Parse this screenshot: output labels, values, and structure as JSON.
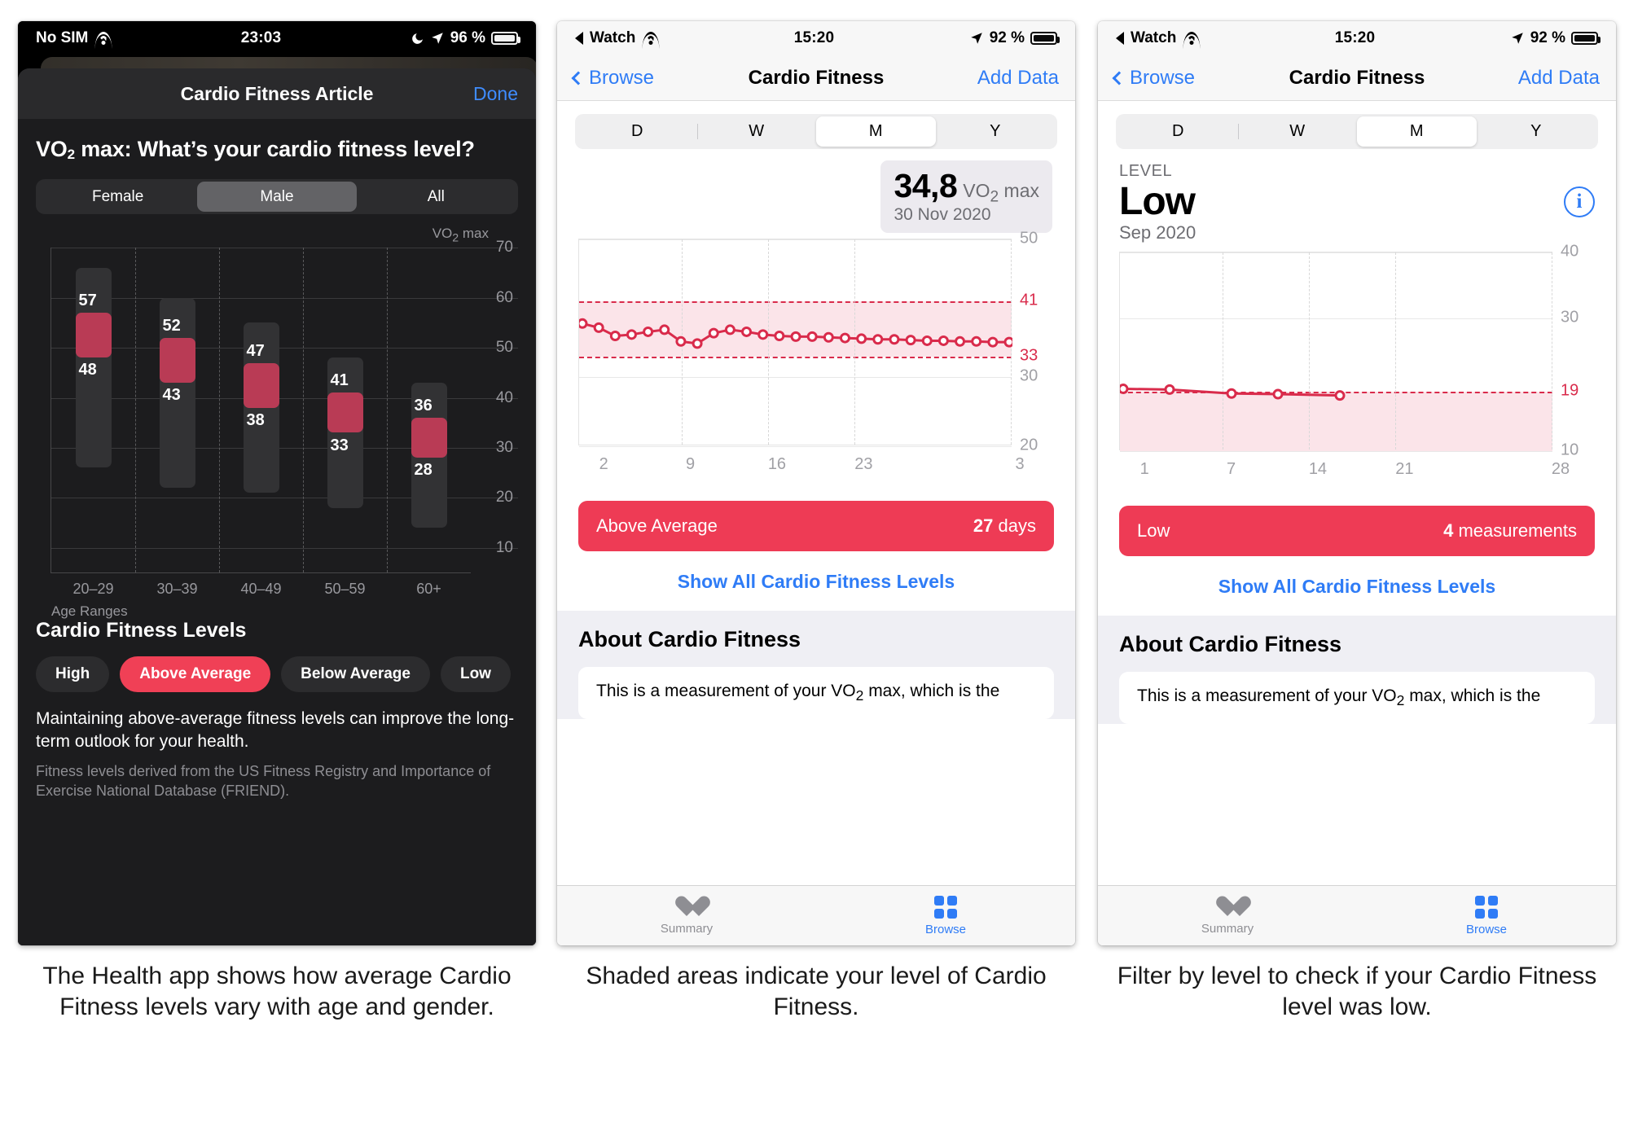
{
  "panel1": {
    "status": {
      "carrier": "No SIM",
      "wifi_icon": "wifi-icon",
      "time": "23:03",
      "moon_icon": "moon-icon",
      "location_icon": "location-arrow-icon",
      "battery": "96 %",
      "battery_icon": "battery-icon"
    },
    "nav": {
      "title": "Cardio Fitness Article",
      "done": "Done"
    },
    "heading_a": "VO",
    "heading_sub": "2",
    "heading_b": " max: What’s your cardio fitness level?",
    "gender_segments": [
      "Female",
      "Male",
      "All"
    ],
    "gender_selected": "Male",
    "axis_unit_a": "VO",
    "axis_unit_sub": "2",
    "axis_unit_b": " max",
    "x_axis_label": "Age Ranges",
    "levels_title": "Cardio Fitness Levels",
    "level_chips": [
      "High",
      "Above Average",
      "Below Average",
      "Low"
    ],
    "level_selected": "Above Average",
    "body_text": "Maintaining above-average fitness levels can improve the long-term outlook for your health.",
    "footnote": "Fitness levels derived from the US Fitness Registry and Importance of Exercise National Database (FRIEND)."
  },
  "panel2": {
    "status": {
      "source": "Watch",
      "back_icon": "back-triangle-icon",
      "wifi_icon": "wifi-icon",
      "time": "15:20",
      "location_icon": "location-arrow-icon",
      "battery": "92 %",
      "battery_icon": "battery-icon"
    },
    "nav": {
      "back": "Browse",
      "title": "Cardio Fitness",
      "action": "Add Data"
    },
    "range_segments": [
      "D",
      "W",
      "M",
      "Y"
    ],
    "range_selected": "M",
    "value": "34,8",
    "value_unit_a": "VO",
    "value_unit_sub": "2",
    "value_unit_b": " max",
    "value_date": "30 Nov 2020",
    "level_bar": {
      "label": "Above Average",
      "count": "27",
      "count_unit": "days"
    },
    "show_all": "Show All Cardio Fitness Levels",
    "about_title": "About Cardio Fitness",
    "about_text_a": "This is a measurement of your VO",
    "about_text_sub": "2",
    "about_text_b": " max, which is the",
    "tabs": [
      {
        "label": "Summary",
        "icon": "heart-icon",
        "active": false
      },
      {
        "label": "Browse",
        "icon": "grid-squares-icon",
        "active": true
      }
    ]
  },
  "panel3": {
    "status": {
      "source": "Watch",
      "back_icon": "back-triangle-icon",
      "wifi_icon": "wifi-icon",
      "time": "15:20",
      "location_icon": "location-arrow-icon",
      "battery": "92 %",
      "battery_icon": "battery-icon"
    },
    "nav": {
      "back": "Browse",
      "title": "Cardio Fitness",
      "action": "Add Data"
    },
    "range_segments": [
      "D",
      "W",
      "M",
      "Y"
    ],
    "range_selected": "M",
    "kicker": "LEVEL",
    "level": "Low",
    "period": "Sep 2020",
    "info_icon": "info-circle-icon",
    "info_glyph": "i",
    "level_bar": {
      "label": "Low",
      "count": "4",
      "count_unit": "measurements"
    },
    "show_all": "Show All Cardio Fitness Levels",
    "about_title": "About Cardio Fitness",
    "about_text_a": "This is a measurement of your VO",
    "about_text_sub": "2",
    "about_text_b": " max, which is the",
    "tabs": [
      {
        "label": "Summary",
        "icon": "heart-icon",
        "active": false
      },
      {
        "label": "Browse",
        "icon": "grid-squares-icon",
        "active": true
      }
    ]
  },
  "captions": {
    "c1": "The Health app shows how average Cardio Fitness levels vary with age and gender.",
    "c2": "Shaded areas indicate your level of Cardio Fitness.",
    "c3": "Filter by level to check if your Cardio Fitness level was low."
  },
  "colors": {
    "accent_red": "#ee3b55",
    "chart_red": "#d92b4b",
    "bar_red": "#b93b55",
    "band_pink": "#fbe4e9",
    "blue": "#2f7cf6",
    "dark_bg": "#1c1c1e"
  },
  "chart_data": [
    {
      "type": "bar",
      "id": "panel1-age-ranges",
      "title": "VO2 max by age range (Male)",
      "ylabel": "VO2 max",
      "xlabel": "Age Ranges",
      "ylim": [
        5,
        70
      ],
      "yticks": [
        70,
        60,
        50,
        40,
        30,
        20,
        10
      ],
      "categories": [
        "20–29",
        "30–39",
        "40–49",
        "50–59",
        "60+"
      ],
      "series": [
        {
          "name": "range_top",
          "values": [
            66,
            60,
            55,
            48,
            43
          ]
        },
        {
          "name": "above_avg_high",
          "values": [
            57,
            52,
            47,
            41,
            36
          ]
        },
        {
          "name": "above_avg_low",
          "values": [
            48,
            43,
            38,
            33,
            28
          ]
        },
        {
          "name": "range_bottom",
          "values": [
            26,
            22,
            21,
            18,
            14
          ]
        }
      ],
      "highlight_band_label": "Above Average",
      "data_labels_top": [
        57,
        52,
        47,
        41,
        36
      ],
      "data_labels_bottom": [
        48,
        43,
        38,
        33,
        28
      ],
      "grid": true
    },
    {
      "type": "line",
      "id": "panel2-monthly-vo2max",
      "ylim": [
        20,
        50
      ],
      "yticks": [
        50,
        41,
        33,
        30,
        20
      ],
      "red_ticks": [
        41,
        33
      ],
      "xticks": [
        "2",
        "9",
        "16",
        "23",
        "3"
      ],
      "band": {
        "from": 33,
        "to": 41,
        "label": "Above Average"
      },
      "x": [
        1,
        2,
        3,
        4,
        5,
        6,
        7,
        8,
        9,
        10,
        11,
        12,
        13,
        14,
        15,
        16,
        17,
        18,
        19,
        20,
        21,
        22,
        23,
        24,
        25,
        26,
        27
      ],
      "values": [
        37.8,
        37.2,
        36.0,
        36.2,
        36.6,
        36.9,
        35.2,
        34.9,
        36.4,
        36.9,
        36.6,
        36.2,
        36.0,
        35.9,
        35.9,
        35.8,
        35.7,
        35.6,
        35.5,
        35.5,
        35.4,
        35.3,
        35.3,
        35.2,
        35.2,
        35.1,
        35.1
      ],
      "grid": true
    },
    {
      "type": "line",
      "id": "panel3-low-level",
      "ylim": [
        10,
        40
      ],
      "yticks": [
        40,
        30,
        19,
        10
      ],
      "red_ticks": [
        19
      ],
      "xticks": [
        "1",
        "7",
        "14",
        "21",
        "28"
      ],
      "band": {
        "from": 10,
        "to": 19,
        "label": "Low"
      },
      "x": [
        1,
        4,
        8,
        11,
        15
      ],
      "values": [
        19.4,
        19.3,
        18.7,
        18.6,
        18.4
      ],
      "grid": true
    }
  ]
}
